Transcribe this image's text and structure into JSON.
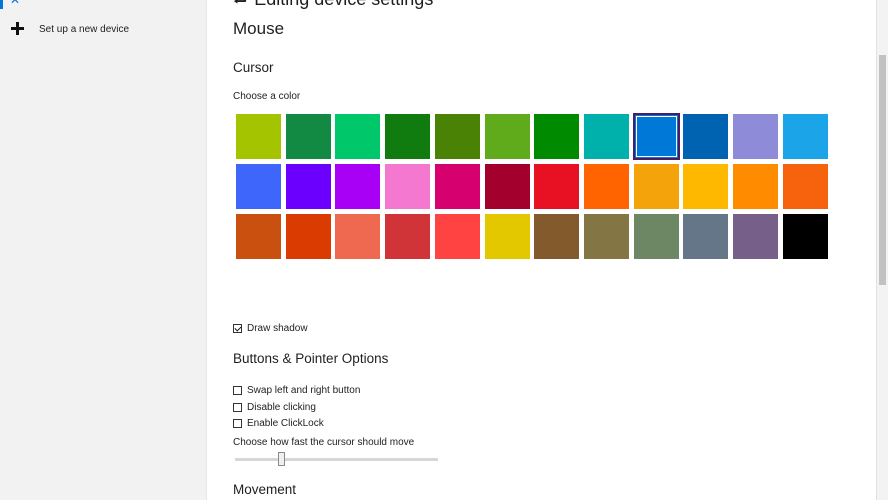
{
  "sidebar": {
    "items": [
      {
        "label": "Set up a new device",
        "icon": "plus-icon"
      }
    ]
  },
  "main": {
    "cut_heading": "Editing device settings",
    "title": "Mouse",
    "cursor": {
      "section_title": "Cursor",
      "choose_color_label": "Choose a color",
      "colors": [
        "#a4c400",
        "#128a43",
        "#00c86a",
        "#107c10",
        "#498205",
        "#60ab1b",
        "#008a00",
        "#00b0aa",
        "#0078d7",
        "#0063b1",
        "#8e8cd8",
        "#1ca4e8",
        "#3e66fb",
        "#6b00ff",
        "#a800f7",
        "#f477d0",
        "#d6006e",
        "#a4002e",
        "#e81123",
        "#ff6400",
        "#f4a30b",
        "#ffb800",
        "#ff8c00",
        "#f7630c",
        "#ca5010",
        "#da3b01",
        "#ef6950",
        "#d13438",
        "#ff4343",
        "#e3c800",
        "#825a2c",
        "#847545",
        "#6d8764",
        "#647687",
        "#76608a",
        "#000000"
      ],
      "selected_index": 8,
      "draw_shadow": {
        "label": "Draw shadow",
        "checked": true
      }
    },
    "buttons": {
      "section_title": "Buttons & Pointer Options",
      "options": [
        {
          "label": "Swap left and right button",
          "checked": false
        },
        {
          "label": "Disable clicking",
          "checked": false
        },
        {
          "label": "Enable ClickLock",
          "checked": false
        }
      ],
      "speed_label": "Choose how fast the cursor should move",
      "speed_value": 0.22
    },
    "movement": {
      "section_title": "Movement"
    }
  }
}
